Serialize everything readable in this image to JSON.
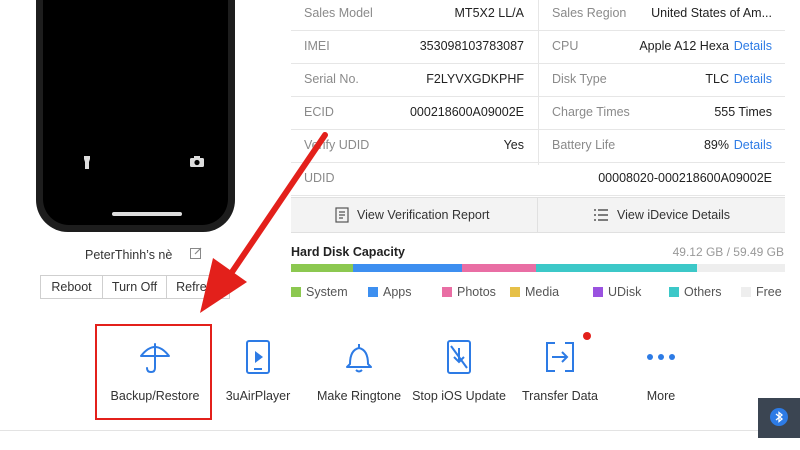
{
  "device": {
    "name": "PeterThinh’s nè",
    "controls": [
      "Reboot",
      "Turn Off",
      "Refresh"
    ]
  },
  "info_rows": [
    {
      "left_label": "Sales Model",
      "left_value": "MT5X2 LL/A",
      "right_label": "Sales Region",
      "right_value": "United States of Am...",
      "right_link": ""
    },
    {
      "left_label": "IMEI",
      "left_value": "353098103783087",
      "right_label": "CPU",
      "right_value": "Apple A12 Hexa",
      "right_link": "Details"
    },
    {
      "left_label": "Serial No.",
      "left_value": "F2LYVXGDKPHF",
      "right_label": "Disk Type",
      "right_value": "TLC",
      "right_link": "Details"
    },
    {
      "left_label": "ECID",
      "left_value": "000218600A09002E",
      "right_label": "Charge Times",
      "right_value": "555 Times",
      "right_link": ""
    },
    {
      "left_label": "Verify UDID",
      "left_value": "Yes",
      "right_label": "Battery Life",
      "right_value": "89%",
      "right_link": "Details"
    }
  ],
  "udid": {
    "label": "UDID",
    "value": "00008020-000218600A09002E"
  },
  "actions": {
    "verification": "View Verification Report",
    "idevice": "View iDevice Details"
  },
  "disk": {
    "title": "Hard Disk Capacity",
    "size": "49.12 GB / 59.49 GB",
    "segments": [
      {
        "name": "System",
        "color": "#8cc850",
        "fraction": 0.125
      },
      {
        "name": "Apps",
        "color": "#3d8ff0",
        "fraction": 0.222
      },
      {
        "name": "Photos",
        "color": "#e96ea4",
        "fraction": 0.148
      },
      {
        "name": "Media",
        "color": "#e6c048",
        "fraction": 0.0
      },
      {
        "name": "UDisk",
        "color": "#9a52e0",
        "fraction": 0.0
      },
      {
        "name": "Others",
        "color": "#3cc8c8",
        "fraction": 0.326
      },
      {
        "name": "Free",
        "color": "#eeeeee",
        "fraction": 0.179
      }
    ]
  },
  "toolbar": [
    {
      "label": "Backup/Restore",
      "icon": "umbrella-icon"
    },
    {
      "label": "3uAirPlayer",
      "icon": "play-screen-icon"
    },
    {
      "label": "Make Ringtone",
      "icon": "bell-icon"
    },
    {
      "label": "Stop iOS Update",
      "icon": "stop-update-icon"
    },
    {
      "label": "Transfer Data",
      "icon": "transfer-icon"
    },
    {
      "label": "More",
      "icon": "more-dots-icon"
    }
  ],
  "colors": {
    "accent": "#2d7be5",
    "highlight": "#e3201b"
  }
}
